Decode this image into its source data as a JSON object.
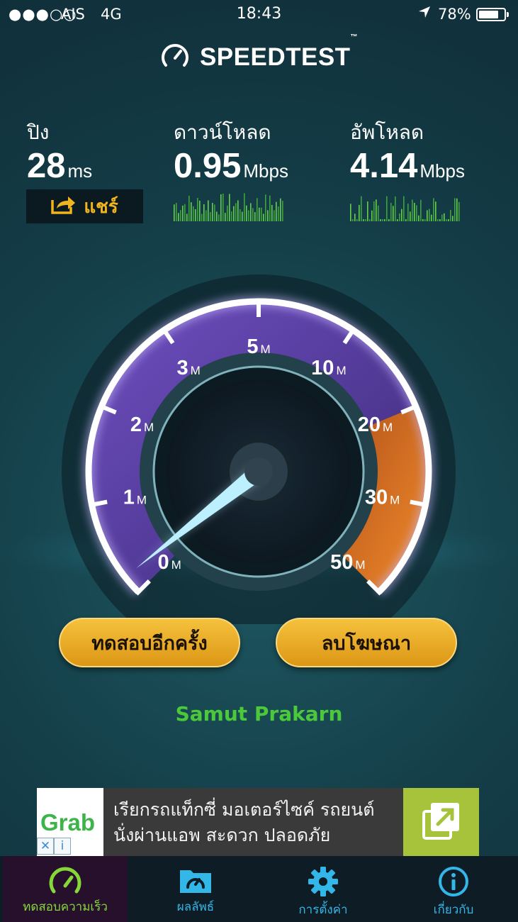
{
  "status_bar": {
    "signal": "●●●○○",
    "carrier": "AIS",
    "network": "4G",
    "time": "18:43",
    "battery_percent": "78%",
    "battery_level": 0.78
  },
  "app": {
    "title": "SPEEDTEST",
    "trademark": "™"
  },
  "stats": {
    "ping": {
      "label": "ปิง",
      "value": "28",
      "unit": "ms"
    },
    "download": {
      "label": "ดาวน์โหลด",
      "value": "0.95",
      "unit": "Mbps"
    },
    "upload": {
      "label": "อัพโหลด",
      "value": "4.14",
      "unit": "Mbps"
    }
  },
  "share_button": {
    "label": "แชร์"
  },
  "gauge": {
    "scale": [
      {
        "value": "0",
        "unit": "M"
      },
      {
        "value": "1",
        "unit": "M"
      },
      {
        "value": "2",
        "unit": "M"
      },
      {
        "value": "3",
        "unit": "M"
      },
      {
        "value": "5",
        "unit": "M"
      },
      {
        "value": "10",
        "unit": "M"
      },
      {
        "value": "20",
        "unit": "M"
      },
      {
        "value": "30",
        "unit": "M"
      },
      {
        "value": "50",
        "unit": "M"
      }
    ],
    "needle_value_mbps": 0.2,
    "colors": {
      "ring": "#ffffff",
      "low_fill": "#5a3fa8",
      "high_fill": "#e67a25",
      "needle": "#bdf0ff"
    }
  },
  "actions": {
    "retest_label": "ทดสอบอีกครั้ง",
    "remove_ads_label": "ลบโฆษณา"
  },
  "server_location": "Samut Prakarn",
  "ad": {
    "brand": "Grab",
    "line1": "เรียกรถแท็กซี่ มอเตอร์ไซค์ รถยนต์",
    "line2": "นั่งผ่านแอพ สะดวก ปลอดภัย",
    "close_glyph": "✕",
    "info_glyph": "i"
  },
  "tabs": [
    {
      "label": "ทดสอบความเร็ว",
      "icon": "speedometer-icon",
      "active": true
    },
    {
      "label": "ผลลัพธ์",
      "icon": "results-folder-icon",
      "active": false
    },
    {
      "label": "การตั้งค่า",
      "icon": "gear-icon",
      "active": false
    },
    {
      "label": "เกี่ยวกับ",
      "icon": "info-icon",
      "active": false
    }
  ],
  "theme": {
    "accent_yellow": "#f0b41c",
    "accent_green": "#4cc93b",
    "tab_blue": "#33b6e8",
    "tab_active_green": "#85d838"
  }
}
